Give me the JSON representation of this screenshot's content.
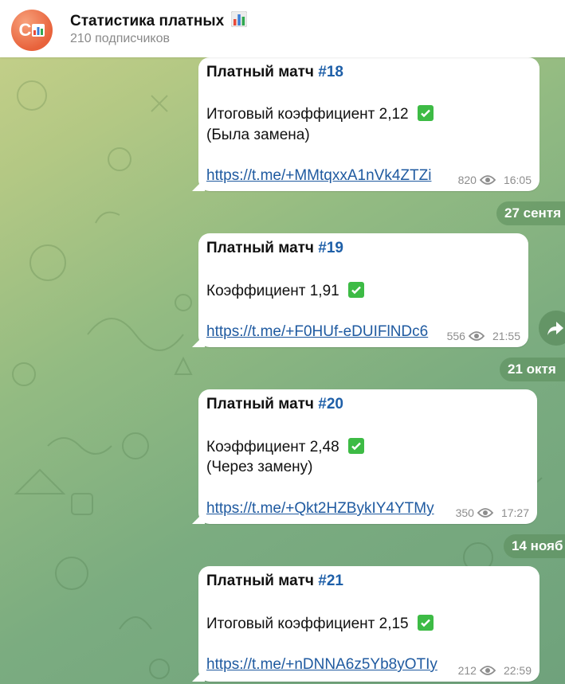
{
  "channel": {
    "avatar_letter": "C",
    "title": "Статистика платных",
    "subscribers": "210 подписчиков"
  },
  "messages": [
    {
      "title": "Платный матч",
      "tag": "#18",
      "line1": "Итоговый коэффициент 2,12",
      "line2": "(Была замена)",
      "link": "https://t.me/+MMtqxxA1nVk4ZTZi",
      "views": "820",
      "time": "16:05"
    },
    {
      "title": "Платный матч",
      "tag": "#19",
      "line1": "Коэффициент 1,91",
      "link": "https://t.me/+F0HUf-eDUIFlNDc6",
      "views": "556",
      "time": "21:55"
    },
    {
      "title": "Платный матч",
      "tag": "#20",
      "line1": "Коэффициент 2,48",
      "line2": "(Через замену)",
      "link": "https://t.me/+Qkt2HZBykIY4YTMy",
      "views": "350",
      "time": "17:27"
    },
    {
      "title": "Платный матч",
      "tag": "#21",
      "line1": "Итоговый коэффициент 2,15",
      "link": "https://t.me/+nDNNA6z5Yb8yOTIy",
      "views": "212",
      "time": "22:59"
    }
  ],
  "date_separators": [
    "27 сентя",
    "21 октя",
    "14 нояб"
  ],
  "icons": {
    "views": "eye-icon",
    "check": "check-mark-button-icon",
    "share": "share-arrow-icon",
    "channel_emoji": "bar-chart-icon"
  },
  "colors": {
    "accent_link": "#1f5aa0",
    "check_green": "#3dbb45",
    "avatar": "#e8623b"
  }
}
